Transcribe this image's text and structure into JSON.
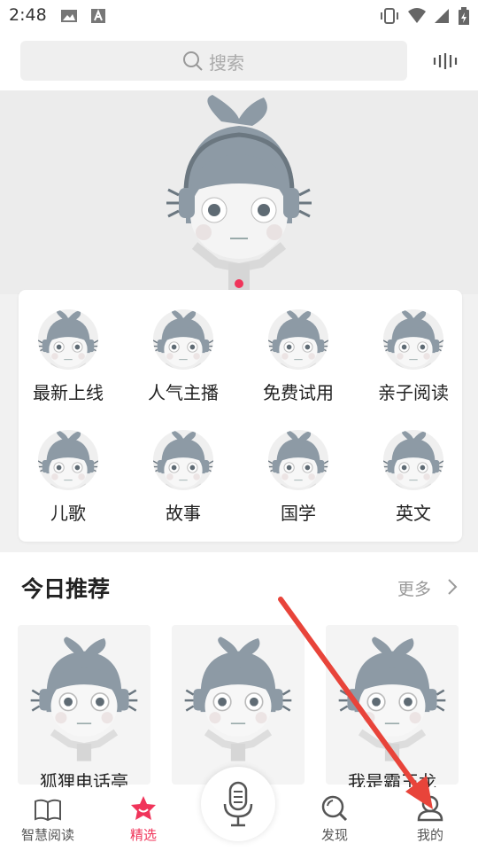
{
  "status_bar": {
    "time": "2:48"
  },
  "search": {
    "placeholder": "搜索"
  },
  "categories": [
    {
      "label": "最新上线"
    },
    {
      "label": "人气主播"
    },
    {
      "label": "免费试用"
    },
    {
      "label": "亲子阅读"
    },
    {
      "label": "儿歌"
    },
    {
      "label": "故事"
    },
    {
      "label": "国学"
    },
    {
      "label": "英文"
    }
  ],
  "recommend": {
    "title": "今日推荐",
    "more": "更多",
    "items": [
      {
        "title": "狐狸电话亭"
      },
      {
        "title": ""
      },
      {
        "title": "我是霸王龙"
      }
    ]
  },
  "tabbar": {
    "items": [
      {
        "label": "智慧阅读",
        "icon": "book-icon"
      },
      {
        "label": "精选",
        "icon": "star-face-icon"
      },
      {
        "label": "",
        "icon": "microphone-icon"
      },
      {
        "label": "发现",
        "icon": "search-icon"
      },
      {
        "label": "我的",
        "icon": "person-icon"
      }
    ],
    "active_index": 1
  },
  "colors": {
    "accent": "#f0345a",
    "annotation_arrow": "#e8443a"
  }
}
